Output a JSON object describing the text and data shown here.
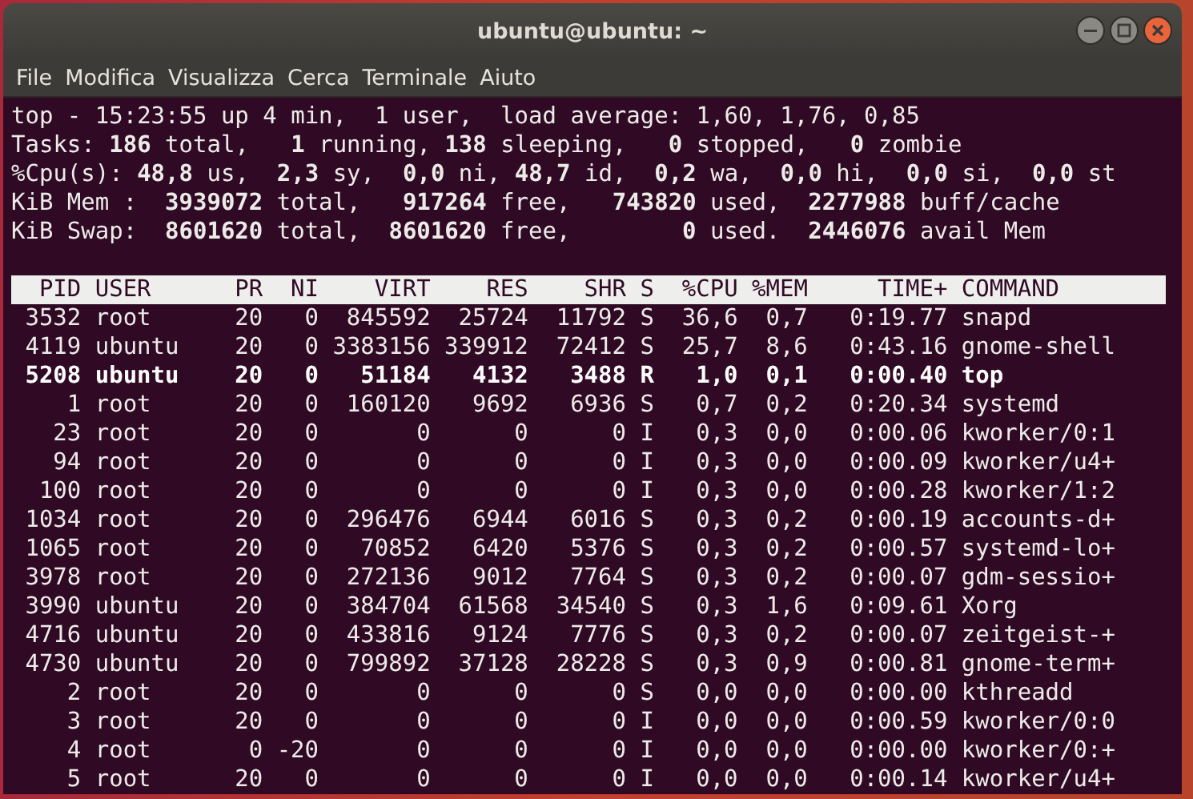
{
  "window": {
    "title": "ubuntu@ubuntu: ~"
  },
  "menu": [
    "File",
    "Modifica",
    "Visualizza",
    "Cerca",
    "Terminale",
    "Aiuto"
  ],
  "summary": [
    "top - 15:23:55 up 4 min,  1 user,  load average: 1,60, 1,76, 0,85",
    "Tasks: **186** total,   **1** running, **138** sleeping,   **0** stopped,   **0** zombie",
    "%Cpu(s): **48,8** us,  **2,3** sy,  **0,0** ni, **48,7** id,  **0,2** wa,  **0,0** hi,  **0,0** si,  **0,0** st",
    "KiB Mem :  **3939072** total,   **917264** free,   **743820** used,  **2277988** buff/cache",
    "KiB Swap:  **8601620** total,  **8601620** free,        **0** used.  **2446076** avail Mem"
  ],
  "table": {
    "columns": [
      "PID",
      "USER",
      "PR",
      "NI",
      "VIRT",
      "RES",
      "SHR",
      "S",
      "%CPU",
      "%MEM",
      "TIME+",
      "COMMAND"
    ],
    "rows": [
      {
        "highlighted": false,
        "cells": [
          "3532",
          "root",
          "20",
          "0",
          "845592",
          "25724",
          "11792",
          "S",
          "36,6",
          "0,7",
          "0:19.77",
          "snapd"
        ]
      },
      {
        "highlighted": false,
        "cells": [
          "4119",
          "ubuntu",
          "20",
          "0",
          "3383156",
          "339912",
          "72412",
          "S",
          "25,7",
          "8,6",
          "0:43.16",
          "gnome-shell"
        ]
      },
      {
        "highlighted": true,
        "cells": [
          "5208",
          "ubuntu",
          "20",
          "0",
          "51184",
          "4132",
          "3488",
          "R",
          "1,0",
          "0,1",
          "0:00.40",
          "top"
        ]
      },
      {
        "highlighted": false,
        "cells": [
          "1",
          "root",
          "20",
          "0",
          "160120",
          "9692",
          "6936",
          "S",
          "0,7",
          "0,2",
          "0:20.34",
          "systemd"
        ]
      },
      {
        "highlighted": false,
        "cells": [
          "23",
          "root",
          "20",
          "0",
          "0",
          "0",
          "0",
          "I",
          "0,3",
          "0,0",
          "0:00.06",
          "kworker/0:1"
        ]
      },
      {
        "highlighted": false,
        "cells": [
          "94",
          "root",
          "20",
          "0",
          "0",
          "0",
          "0",
          "I",
          "0,3",
          "0,0",
          "0:00.09",
          "kworker/u4+"
        ]
      },
      {
        "highlighted": false,
        "cells": [
          "100",
          "root",
          "20",
          "0",
          "0",
          "0",
          "0",
          "I",
          "0,3",
          "0,0",
          "0:00.28",
          "kworker/1:2"
        ]
      },
      {
        "highlighted": false,
        "cells": [
          "1034",
          "root",
          "20",
          "0",
          "296476",
          "6944",
          "6016",
          "S",
          "0,3",
          "0,2",
          "0:00.19",
          "accounts-d+"
        ]
      },
      {
        "highlighted": false,
        "cells": [
          "1065",
          "root",
          "20",
          "0",
          "70852",
          "6420",
          "5376",
          "S",
          "0,3",
          "0,2",
          "0:00.57",
          "systemd-lo+"
        ]
      },
      {
        "highlighted": false,
        "cells": [
          "3978",
          "root",
          "20",
          "0",
          "272136",
          "9012",
          "7764",
          "S",
          "0,3",
          "0,2",
          "0:00.07",
          "gdm-sessio+"
        ]
      },
      {
        "highlighted": false,
        "cells": [
          "3990",
          "ubuntu",
          "20",
          "0",
          "384704",
          "61568",
          "34540",
          "S",
          "0,3",
          "1,6",
          "0:09.61",
          "Xorg"
        ]
      },
      {
        "highlighted": false,
        "cells": [
          "4716",
          "ubuntu",
          "20",
          "0",
          "433816",
          "9124",
          "7776",
          "S",
          "0,3",
          "0,2",
          "0:00.07",
          "zeitgeist-+"
        ]
      },
      {
        "highlighted": false,
        "cells": [
          "4730",
          "ubuntu",
          "20",
          "0",
          "799892",
          "37128",
          "28228",
          "S",
          "0,3",
          "0,9",
          "0:00.81",
          "gnome-term+"
        ]
      },
      {
        "highlighted": false,
        "cells": [
          "2",
          "root",
          "20",
          "0",
          "0",
          "0",
          "0",
          "S",
          "0,0",
          "0,0",
          "0:00.00",
          "kthreadd"
        ]
      },
      {
        "highlighted": false,
        "cells": [
          "3",
          "root",
          "20",
          "0",
          "0",
          "0",
          "0",
          "I",
          "0,0",
          "0,0",
          "0:00.59",
          "kworker/0:0"
        ]
      },
      {
        "highlighted": false,
        "cells": [
          "4",
          "root",
          "0",
          "-20",
          "0",
          "0",
          "0",
          "I",
          "0,0",
          "0,0",
          "0:00.00",
          "kworker/0:+"
        ]
      },
      {
        "highlighted": false,
        "cells": [
          "5",
          "root",
          "20",
          "0",
          "0",
          "0",
          "0",
          "I",
          "0,0",
          "0,0",
          "0:00.14",
          "kworker/u4+"
        ]
      }
    ]
  }
}
